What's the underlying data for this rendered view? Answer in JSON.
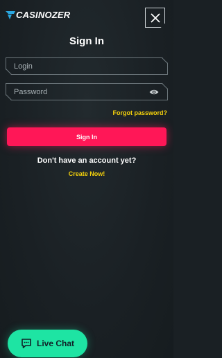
{
  "brand": {
    "name": "CASINOZER",
    "logo_icon": "casinozer-logo-icon"
  },
  "header": {
    "close_icon": "close-icon"
  },
  "form": {
    "title": "Sign In",
    "login_placeholder": "Login",
    "password_placeholder": "Password",
    "eye_icon": "eye-icon",
    "forgot_label": "Forgot password?",
    "submit_label": "Sign In"
  },
  "signup": {
    "prompt": "Don't have an account yet?",
    "link_label": "Create Now!"
  },
  "chat": {
    "label": "Live Chat",
    "icon": "chat-bubble-icon"
  },
  "colors": {
    "background": "#1a2024",
    "accent_pink": "#ff1757",
    "accent_yellow": "#f5d20b",
    "accent_green": "#1ee4a3",
    "logo_blue": "#2aa7e0"
  }
}
